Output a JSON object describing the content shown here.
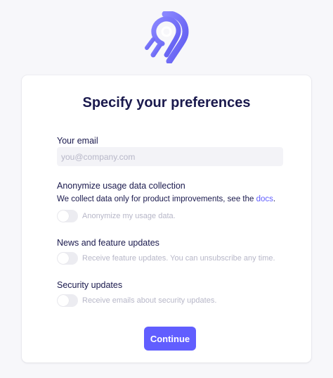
{
  "colors": {
    "brand": "#615eff",
    "title": "#1a194d",
    "muted": "#b7b7c8",
    "background": "#f7f7fa"
  },
  "logo": {
    "icon": "airbyte-logo-icon"
  },
  "form": {
    "title": "Specify your preferences",
    "email": {
      "label": "Your email",
      "value": "",
      "placeholder": "you@company.com"
    },
    "anonymize": {
      "heading": "Anonymize usage data collection",
      "description_prefix": "We collect data only for product improvements, see the ",
      "docs_link": "docs",
      "description_suffix": ".",
      "toggle_label": "Anonymize my usage data.",
      "enabled": false
    },
    "news": {
      "heading": "News and feature updates",
      "toggle_label": "Receive feature updates. You can unsubscribe any time.",
      "enabled": false
    },
    "security": {
      "heading": "Security updates",
      "toggle_label": "Receive emails about security updates.",
      "enabled": false
    },
    "continue_label": "Continue"
  }
}
